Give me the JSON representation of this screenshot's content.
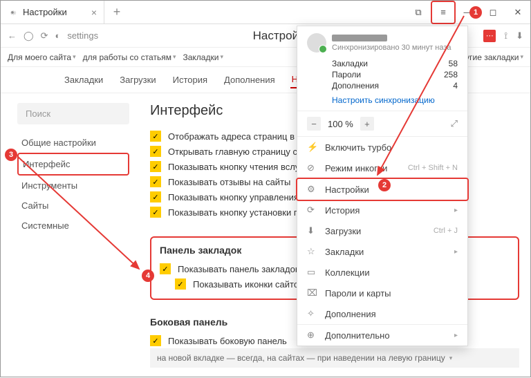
{
  "titlebar": {
    "tab_title": "Настройки",
    "close": "×",
    "newtab": "+"
  },
  "addrbar": {
    "url": "settings",
    "heading": "Настройки"
  },
  "bookmarks": {
    "items": [
      "Для моего сайта",
      "для работы со статьям",
      "Закладки"
    ],
    "right": "Другие закладки"
  },
  "tabs": [
    "Закладки",
    "Загрузки",
    "История",
    "Дополнения",
    "Настройки"
  ],
  "sidebar": {
    "search": "Поиск",
    "items": [
      "Общие настройки",
      "Интерфейс",
      "Инструменты",
      "Сайты",
      "Системные"
    ]
  },
  "content": {
    "h2": "Интерфейс",
    "checks": [
      "Отображать адреса страниц в ви",
      "Открывать главную страницу сай",
      "Показывать кнопку чтения вслух",
      "Показывать отзывы на сайты",
      "Показывать кнопку управления п",
      "Показывать кнопку установки пр"
    ],
    "panel_title": "Панель закладок",
    "panel_checks": [
      "Показывать панель закладок",
      "Показывать иконки сайтов"
    ],
    "side_title": "Боковая панель",
    "side_check": "Показывать боковую панель",
    "side_dropdown": "на новой вкладке — всегда, на сайтах — при наведении на левую границу"
  },
  "menu": {
    "sync_sub": "Синхронизировано 30 минут наза",
    "stats": [
      {
        "label": "Закладки",
        "val": "58"
      },
      {
        "label": "Пароли",
        "val": "258"
      },
      {
        "label": "Дополнения",
        "val": "4"
      }
    ],
    "sync_link": "Настроить синхронизацию",
    "zoom": "100 %",
    "items": [
      {
        "icon": "⚡",
        "label": "Включить турбо"
      },
      {
        "icon": "⊘",
        "label": "Режим инкогни",
        "shortcut": "Ctrl + Shift + N"
      },
      {
        "icon": "⚙",
        "label": "Настройки",
        "hl": true
      },
      {
        "icon": "⟳",
        "label": "История",
        "chev": true
      },
      {
        "icon": "⬇",
        "label": "Загрузки",
        "shortcut": "Ctrl + J"
      },
      {
        "icon": "☆",
        "label": "Закладки",
        "chev": true
      },
      {
        "icon": "▭",
        "label": "Коллекции"
      },
      {
        "icon": "⌧",
        "label": "Пароли и карты"
      },
      {
        "icon": "✧",
        "label": "Дополнения"
      },
      {
        "icon": "⊕",
        "label": "Дополнительно",
        "chev": true
      }
    ]
  },
  "markers": {
    "m1": "1",
    "m2": "2",
    "m3": "3",
    "m4": "4"
  }
}
